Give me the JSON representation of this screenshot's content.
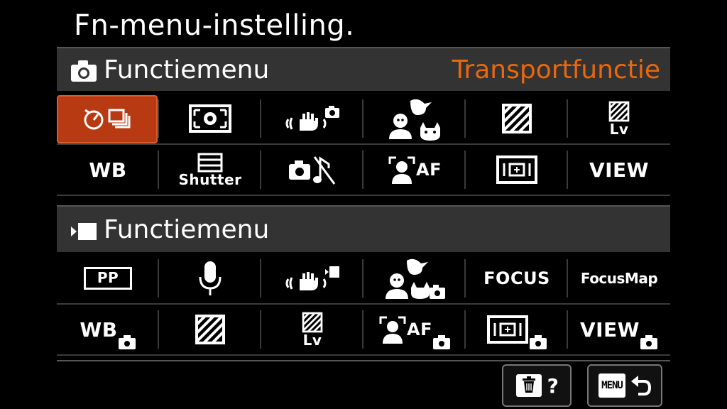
{
  "title": "Fn-menu-instelling.",
  "photo_section": {
    "header_label": "Functiemenu",
    "header_icon": "camera-icon",
    "selected_item_name": "Transportfunctie",
    "row1": [
      {
        "name": "drive-mode",
        "icon": "self-timer-continuous-icon",
        "selected": true
      },
      {
        "name": "metering-mode",
        "icon": "metering-icon"
      },
      {
        "name": "steadyshot",
        "icon": "steadyshot-photo-icon"
      },
      {
        "name": "face-eye-subject",
        "icon": "subject-detect-icon"
      },
      {
        "name": "picture-effect",
        "icon": "hatched-square-icon"
      },
      {
        "name": "live-view",
        "icon": "hatched-square-lv-icon",
        "label": "Lv"
      }
    ],
    "row2": [
      {
        "name": "white-balance",
        "label": "WB"
      },
      {
        "name": "shutter-type",
        "icon": "shutter-icon",
        "label": "Shutter"
      },
      {
        "name": "silent-mode",
        "icon": "camera-mute-icon"
      },
      {
        "name": "face-af",
        "icon": "face-af-icon",
        "label": "AF"
      },
      {
        "name": "focus-area",
        "icon": "focus-area-icon"
      },
      {
        "name": "view-mode",
        "label": "VIEW"
      }
    ]
  },
  "movie_section": {
    "header_label": "Functiemenu",
    "header_icon": "movie-icon",
    "row1": [
      {
        "name": "picture-profile",
        "label": "PP"
      },
      {
        "name": "audio",
        "icon": "microphone-icon"
      },
      {
        "name": "steadyshot-movie",
        "icon": "steadyshot-movie-icon"
      },
      {
        "name": "subject-detect-movie",
        "icon": "subject-detect-icon"
      },
      {
        "name": "focus-mode",
        "label": "FOCUS"
      },
      {
        "name": "focus-map",
        "label": "FocusMap"
      }
    ],
    "row2": [
      {
        "name": "white-balance-photo",
        "label": "WB"
      },
      {
        "name": "picture-effect-photo",
        "icon": "hatched-square-icon"
      },
      {
        "name": "live-view-photo",
        "icon": "hatched-square-lv-icon",
        "label": "Lv"
      },
      {
        "name": "face-af-photo",
        "icon": "face-af-icon",
        "label": "AF"
      },
      {
        "name": "focus-area-photo",
        "icon": "focus-area-icon"
      },
      {
        "name": "view-mode-photo",
        "label": "VIEW"
      }
    ]
  },
  "footer": {
    "delete_label": "?",
    "menu_label": "MENU"
  }
}
